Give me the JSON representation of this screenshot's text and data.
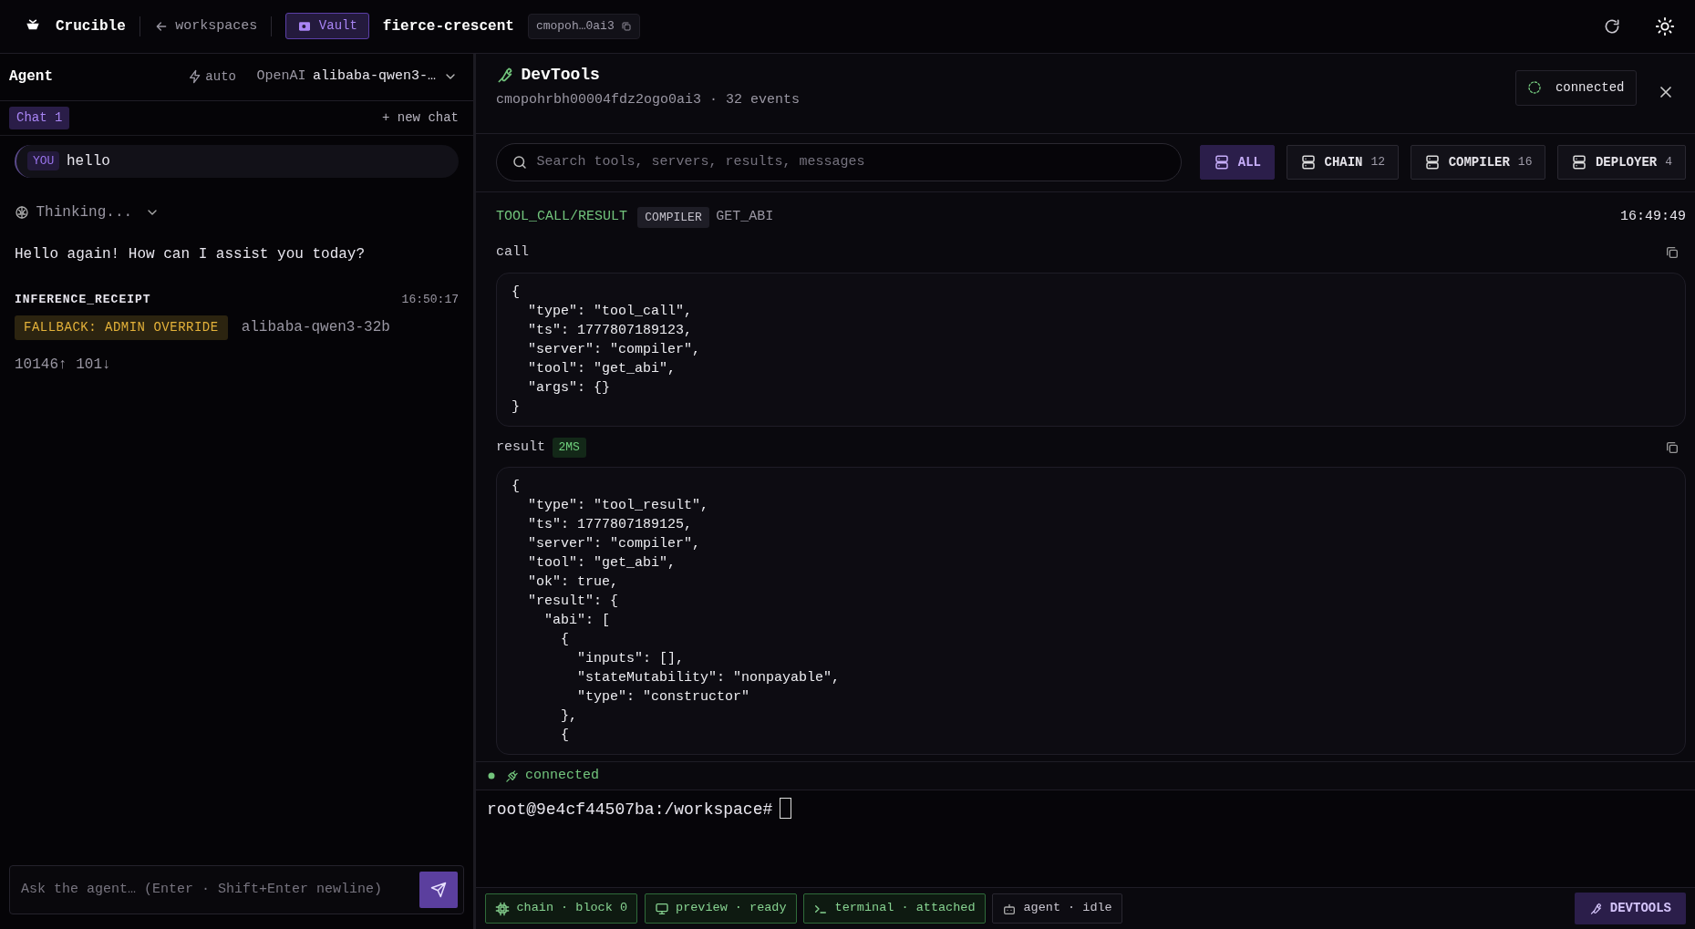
{
  "topbar": {
    "brand": "Crucible",
    "back_link": "workspaces",
    "vault": "Vault",
    "workspace": "fierce-crescent",
    "workspace_id": "cmopoh…0ai3"
  },
  "agent": {
    "title": "Agent",
    "mode": "auto",
    "provider": "OpenAI",
    "model": "alibaba-qwen3-…",
    "tabs": [
      {
        "label": "Chat 1",
        "selected": true
      }
    ],
    "new_chat": "+ new chat",
    "messages": [
      {
        "kind": "user",
        "badge": "YOU",
        "text": "hello"
      },
      {
        "kind": "thinking",
        "text": "Thinking...",
        "expanded": false
      },
      {
        "kind": "assistant",
        "text": "Hello again! How can I assist you today?"
      },
      {
        "kind": "receipt",
        "title": "INFERENCE_RECEIPT",
        "time": "16:50:17",
        "tag": "FALLBACK: ADMIN OVERRIDE",
        "model": "alibaba-qwen3-32b",
        "tokens": "10146↑ 101↓"
      }
    ],
    "input": {
      "placeholder": "Ask the agent… (Enter · Shift+Enter newline)"
    }
  },
  "devtools": {
    "title": "DevTools",
    "session": "cmopohrbh00004fdz2ogo0ai3 · 32 events",
    "status": "connected",
    "search": {
      "placeholder": "Search tools, servers, results, messages"
    },
    "filters": [
      {
        "label": "ALL",
        "selected": true
      },
      {
        "label": "CHAIN",
        "count": "12",
        "selected": false
      },
      {
        "label": "COMPILER",
        "count": "16",
        "selected": false
      },
      {
        "label": "DEPLOYER",
        "count": "4",
        "selected": false
      }
    ],
    "event": {
      "type": "TOOL_CALL/RESULT",
      "server": "COMPILER",
      "tool": "GET_ABI",
      "time": "16:49:49",
      "sections": [
        {
          "label": "call",
          "code": [
            "{",
            "  \"type\": \"tool_call\",",
            "  \"ts\": 1777807189123,",
            "  \"server\": \"compiler\",",
            "  \"tool\": \"get_abi\",",
            "  \"args\": {}",
            "}"
          ]
        },
        {
          "label": "result",
          "badge": "2MS",
          "code": [
            "{",
            "  \"type\": \"tool_result\",",
            "  \"ts\": 1777807189125,",
            "  \"server\": \"compiler\",",
            "  \"tool\": \"get_abi\",",
            "  \"ok\": true,",
            "  \"result\": {",
            "    \"abi\": [",
            "      {",
            "        \"inputs\": [],",
            "        \"stateMutability\": \"nonpayable\",",
            "        \"type\": \"constructor\"",
            "      },",
            "      {"
          ]
        }
      ]
    }
  },
  "terminal": {
    "status": "connected",
    "prompt": "root@9e4cf44507ba:/workspace#"
  },
  "status_bar": {
    "items": [
      {
        "kind": "chain",
        "label": "chain · block 0"
      },
      {
        "kind": "preview",
        "label": "preview · ready"
      },
      {
        "kind": "terminal",
        "label": "terminal · attached"
      },
      {
        "kind": "agent",
        "label": "agent · idle"
      }
    ],
    "devtools_button": "DEVTOOLS"
  }
}
